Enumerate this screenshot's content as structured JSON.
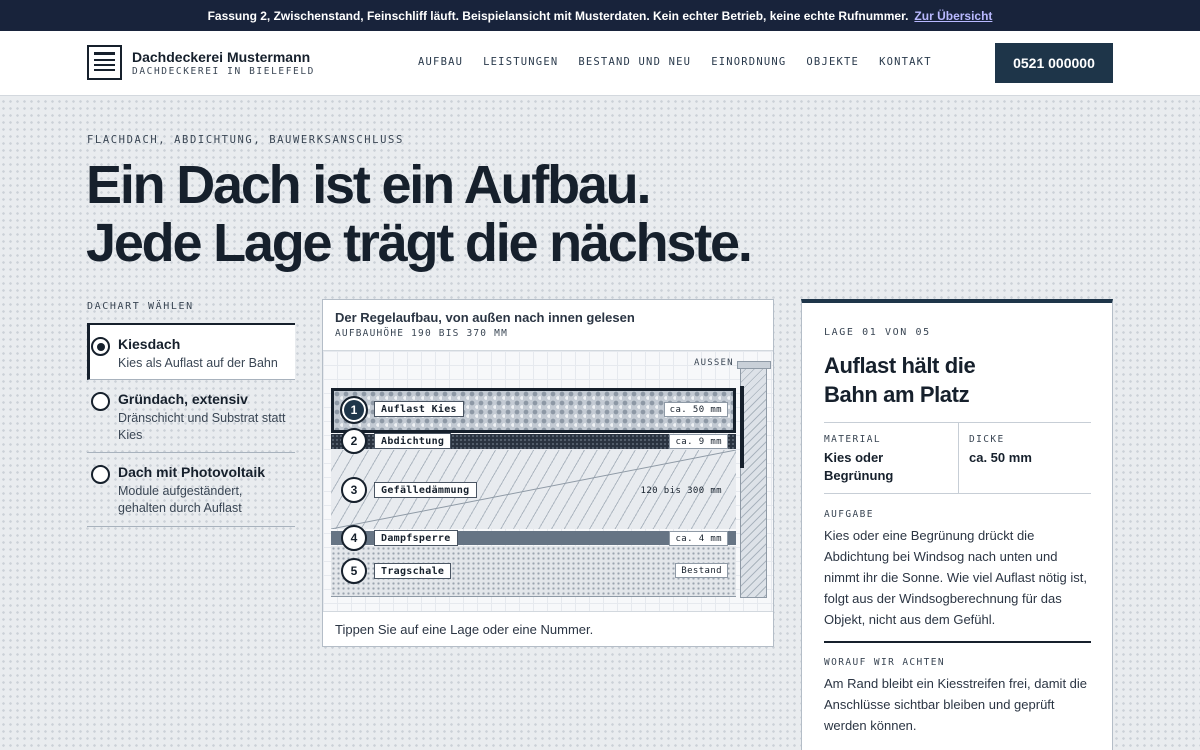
{
  "notice": {
    "text": "Fassung 2, Zwischenstand, Feinschliff läuft. Beispielansicht mit Musterdaten. Kein echter Betrieb, keine echte Rufnummer.",
    "link": "Zur Übersicht"
  },
  "header": {
    "brand_name": "Dachdeckerei Mustermann",
    "brand_sub": "DACHDECKEREI IN BIELEFELD",
    "nav": [
      "AUFBAU",
      "LEISTUNGEN",
      "BESTAND UND NEU",
      "EINORDNUNG",
      "OBJEKTE",
      "KONTAKT"
    ],
    "phone": "0521 000000"
  },
  "hero": {
    "eyebrow": "FLACHDACH, ABDICHTUNG, BAUWERKSANSCHLUSS",
    "line1": "Ein Dach ist ein Aufbau.",
    "line2": "Jede Lage trägt die nächste."
  },
  "selector": {
    "label": "DACHART WÄHLEN",
    "options": [
      {
        "title": "Kiesdach",
        "desc": "Kies als Auflast auf der Bahn",
        "selected": true
      },
      {
        "title": "Gründach, extensiv",
        "desc": "Dränschicht und Substrat statt Kies",
        "selected": false
      },
      {
        "title": "Dach mit Photovoltaik",
        "desc": "Module aufgeständert, gehalten durch Auflast",
        "selected": false
      }
    ]
  },
  "diagram": {
    "title": "Der Regelaufbau, von außen nach innen gelesen",
    "subtitle": "AUFBAUHÖHE 190 BIS 370 MM",
    "outside_label": "AUSSEN",
    "hint": "Tippen Sie auf eine Lage oder eine Nummer.",
    "active_layer": 1,
    "layers": [
      {
        "num": "1",
        "name": "Auflast Kies",
        "measure": "ca. 50 mm"
      },
      {
        "num": "2",
        "name": "Abdichtung",
        "measure": "ca. 9 mm"
      },
      {
        "num": "3",
        "name": "Gefälledämmung",
        "measure": "120 bis 300 mm"
      },
      {
        "num": "4",
        "name": "Dampfsperre",
        "measure": "ca. 4 mm"
      },
      {
        "num": "5",
        "name": "Tragschale",
        "measure": "Bestand"
      }
    ]
  },
  "detail": {
    "step": "LAGE 01 VON 05",
    "title_line1": "Auflast hält die",
    "title_line2": "Bahn am Platz",
    "material_label": "MATERIAL",
    "material_value": "Kies oder Begrünung",
    "thickness_label": "DICKE",
    "thickness_value": "ca. 50 mm",
    "task_label": "AUFGABE",
    "task_text": "Kies oder eine Begrünung drückt die Abdichtung bei Windsog nach unten und nimmt ihr die Sonne. Wie viel Auflast nötig ist, folgt aus der Windsogberechnung für das Objekt, nicht aus dem Gefühl.",
    "care_label": "WORAUF WIR ACHTEN",
    "care_text": "Am Rand bleibt ein Kiesstreifen frei, damit die Anschlüsse sichtbar bleiben und geprüft werden können."
  }
}
